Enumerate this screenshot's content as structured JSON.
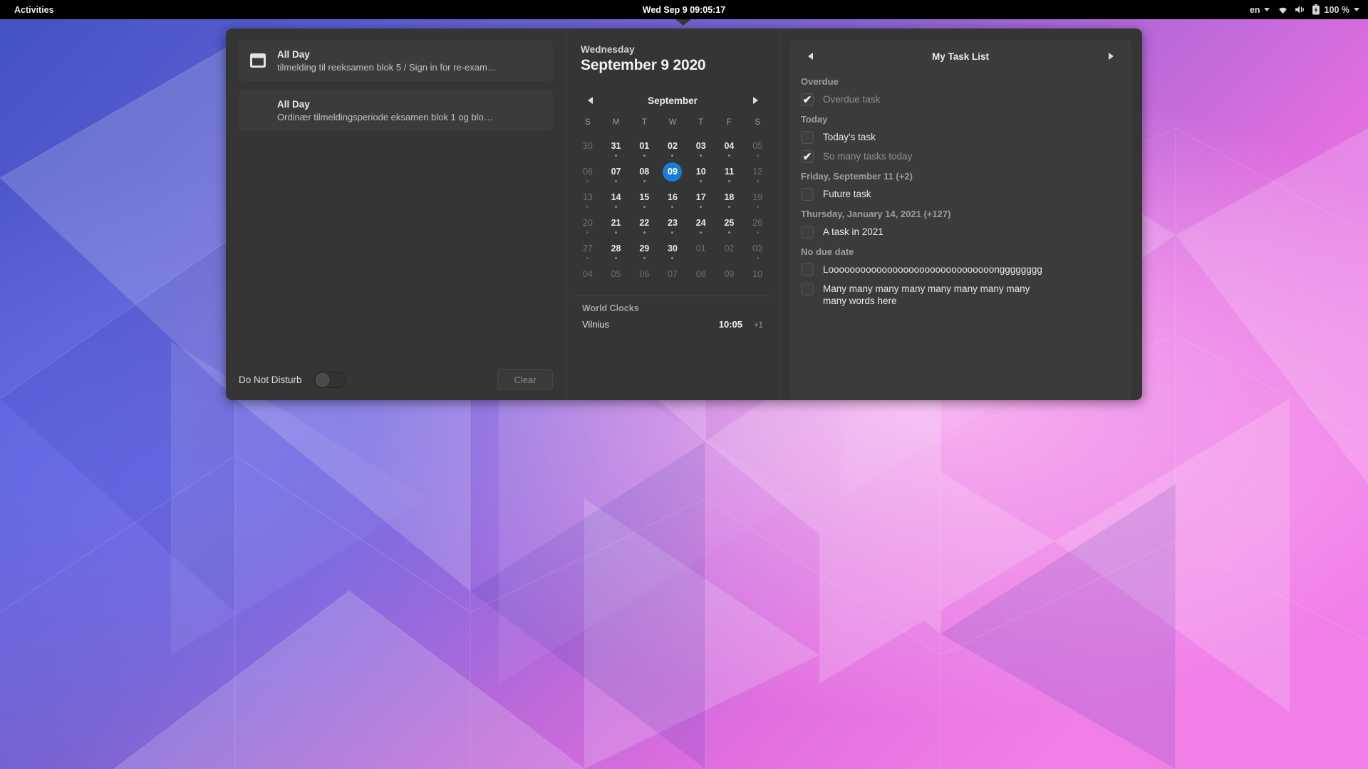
{
  "topbar": {
    "activities": "Activities",
    "clock": "Wed Sep 9  09:05:17",
    "language": "en",
    "battery_percent": "100 %",
    "icons": [
      "wifi-icon",
      "volume-icon",
      "battery-icon"
    ]
  },
  "notifications": {
    "items": [
      {
        "icon": "calendar-icon",
        "title": "All Day",
        "subtitle": "tilmelding til reeksamen blok 5 / Sign in for re-exam…"
      },
      {
        "icon": "calendar-icon",
        "title": "All Day",
        "subtitle": "Ordinær tilmeldingsperiode eksamen blok 1 og blo…"
      }
    ],
    "do_not_disturb_label": "Do Not Disturb",
    "do_not_disturb_on": false,
    "clear_label": "Clear"
  },
  "calendar": {
    "weekday": "Wednesday",
    "full_date": "September 9 2020",
    "month_label": "September",
    "prev_label": "prev-month-arrow",
    "next_label": "next-month-arrow",
    "day_initials": [
      "S",
      "M",
      "T",
      "W",
      "T",
      "F",
      "S"
    ],
    "weeks": [
      [
        {
          "n": "30",
          "other": true,
          "dot": false
        },
        {
          "n": "31",
          "other": false,
          "dot": true
        },
        {
          "n": "01",
          "other": false,
          "dot": true
        },
        {
          "n": "02",
          "other": false,
          "dot": true
        },
        {
          "n": "03",
          "other": false,
          "dot": true
        },
        {
          "n": "04",
          "other": false,
          "dot": true
        },
        {
          "n": "05",
          "other": true,
          "dot": true
        }
      ],
      [
        {
          "n": "06",
          "other": true,
          "dot": true
        },
        {
          "n": "07",
          "other": false,
          "dot": true
        },
        {
          "n": "08",
          "other": false,
          "dot": true
        },
        {
          "n": "09",
          "other": false,
          "dot": false,
          "today": true
        },
        {
          "n": "10",
          "other": false,
          "dot": true
        },
        {
          "n": "11",
          "other": false,
          "dot": true
        },
        {
          "n": "12",
          "other": true,
          "dot": true
        }
      ],
      [
        {
          "n": "13",
          "other": true,
          "dot": true
        },
        {
          "n": "14",
          "other": false,
          "dot": true
        },
        {
          "n": "15",
          "other": false,
          "dot": true
        },
        {
          "n": "16",
          "other": false,
          "dot": true
        },
        {
          "n": "17",
          "other": false,
          "dot": true
        },
        {
          "n": "18",
          "other": false,
          "dot": true
        },
        {
          "n": "19",
          "other": true,
          "dot": true
        }
      ],
      [
        {
          "n": "20",
          "other": true,
          "dot": true
        },
        {
          "n": "21",
          "other": false,
          "dot": true
        },
        {
          "n": "22",
          "other": false,
          "dot": true
        },
        {
          "n": "23",
          "other": false,
          "dot": true
        },
        {
          "n": "24",
          "other": false,
          "dot": true
        },
        {
          "n": "25",
          "other": false,
          "dot": true
        },
        {
          "n": "26",
          "other": true,
          "dot": true
        }
      ],
      [
        {
          "n": "27",
          "other": true,
          "dot": true
        },
        {
          "n": "28",
          "other": false,
          "dot": true
        },
        {
          "n": "29",
          "other": false,
          "dot": true
        },
        {
          "n": "30",
          "other": false,
          "dot": true
        },
        {
          "n": "01",
          "other": true,
          "dot": false
        },
        {
          "n": "02",
          "other": true,
          "dot": false
        },
        {
          "n": "03",
          "other": true,
          "dot": true
        }
      ],
      [
        {
          "n": "04",
          "other": true,
          "dot": false
        },
        {
          "n": "05",
          "other": true,
          "dot": false
        },
        {
          "n": "06",
          "other": true,
          "dot": false
        },
        {
          "n": "07",
          "other": true,
          "dot": false
        },
        {
          "n": "08",
          "other": true,
          "dot": false
        },
        {
          "n": "09",
          "other": true,
          "dot": false
        },
        {
          "n": "10",
          "other": true,
          "dot": false
        }
      ]
    ]
  },
  "world_clocks": {
    "title": "World Clocks",
    "rows": [
      {
        "city": "Vilnius",
        "time": "10:05",
        "offset": "+1"
      }
    ]
  },
  "tasks": {
    "title": "My Task List",
    "prev_label": "prev-list-arrow",
    "next_label": "next-list-arrow",
    "sections": [
      {
        "header": "Overdue",
        "items": [
          {
            "label": "Overdue task",
            "checked": true,
            "wrap": false
          }
        ]
      },
      {
        "header": "Today",
        "items": [
          {
            "label": "Today's task",
            "checked": false,
            "wrap": false
          },
          {
            "label": "So many tasks today",
            "checked": true,
            "wrap": false
          }
        ]
      },
      {
        "header": "Friday, September 11 (+2)",
        "items": [
          {
            "label": "Future task",
            "checked": false,
            "wrap": false
          }
        ]
      },
      {
        "header": "Thursday, January 14, 2021 (+127)",
        "items": [
          {
            "label": "A task in 2021",
            "checked": false,
            "wrap": false
          }
        ]
      },
      {
        "header": "No due date",
        "items": [
          {
            "label": "Looooooooooooooooooooooooooooooongggggggg",
            "checked": false,
            "wrap": false
          },
          {
            "label": "Many many many many many many many many many words  here",
            "checked": false,
            "wrap": true
          }
        ]
      }
    ]
  },
  "colors": {
    "panel_bg": "#353535",
    "card_bg": "#3b3b3b",
    "accent_today": "#1a7fd4",
    "text_primary": "#e9e9e9",
    "text_dim": "#9a9a9a"
  }
}
